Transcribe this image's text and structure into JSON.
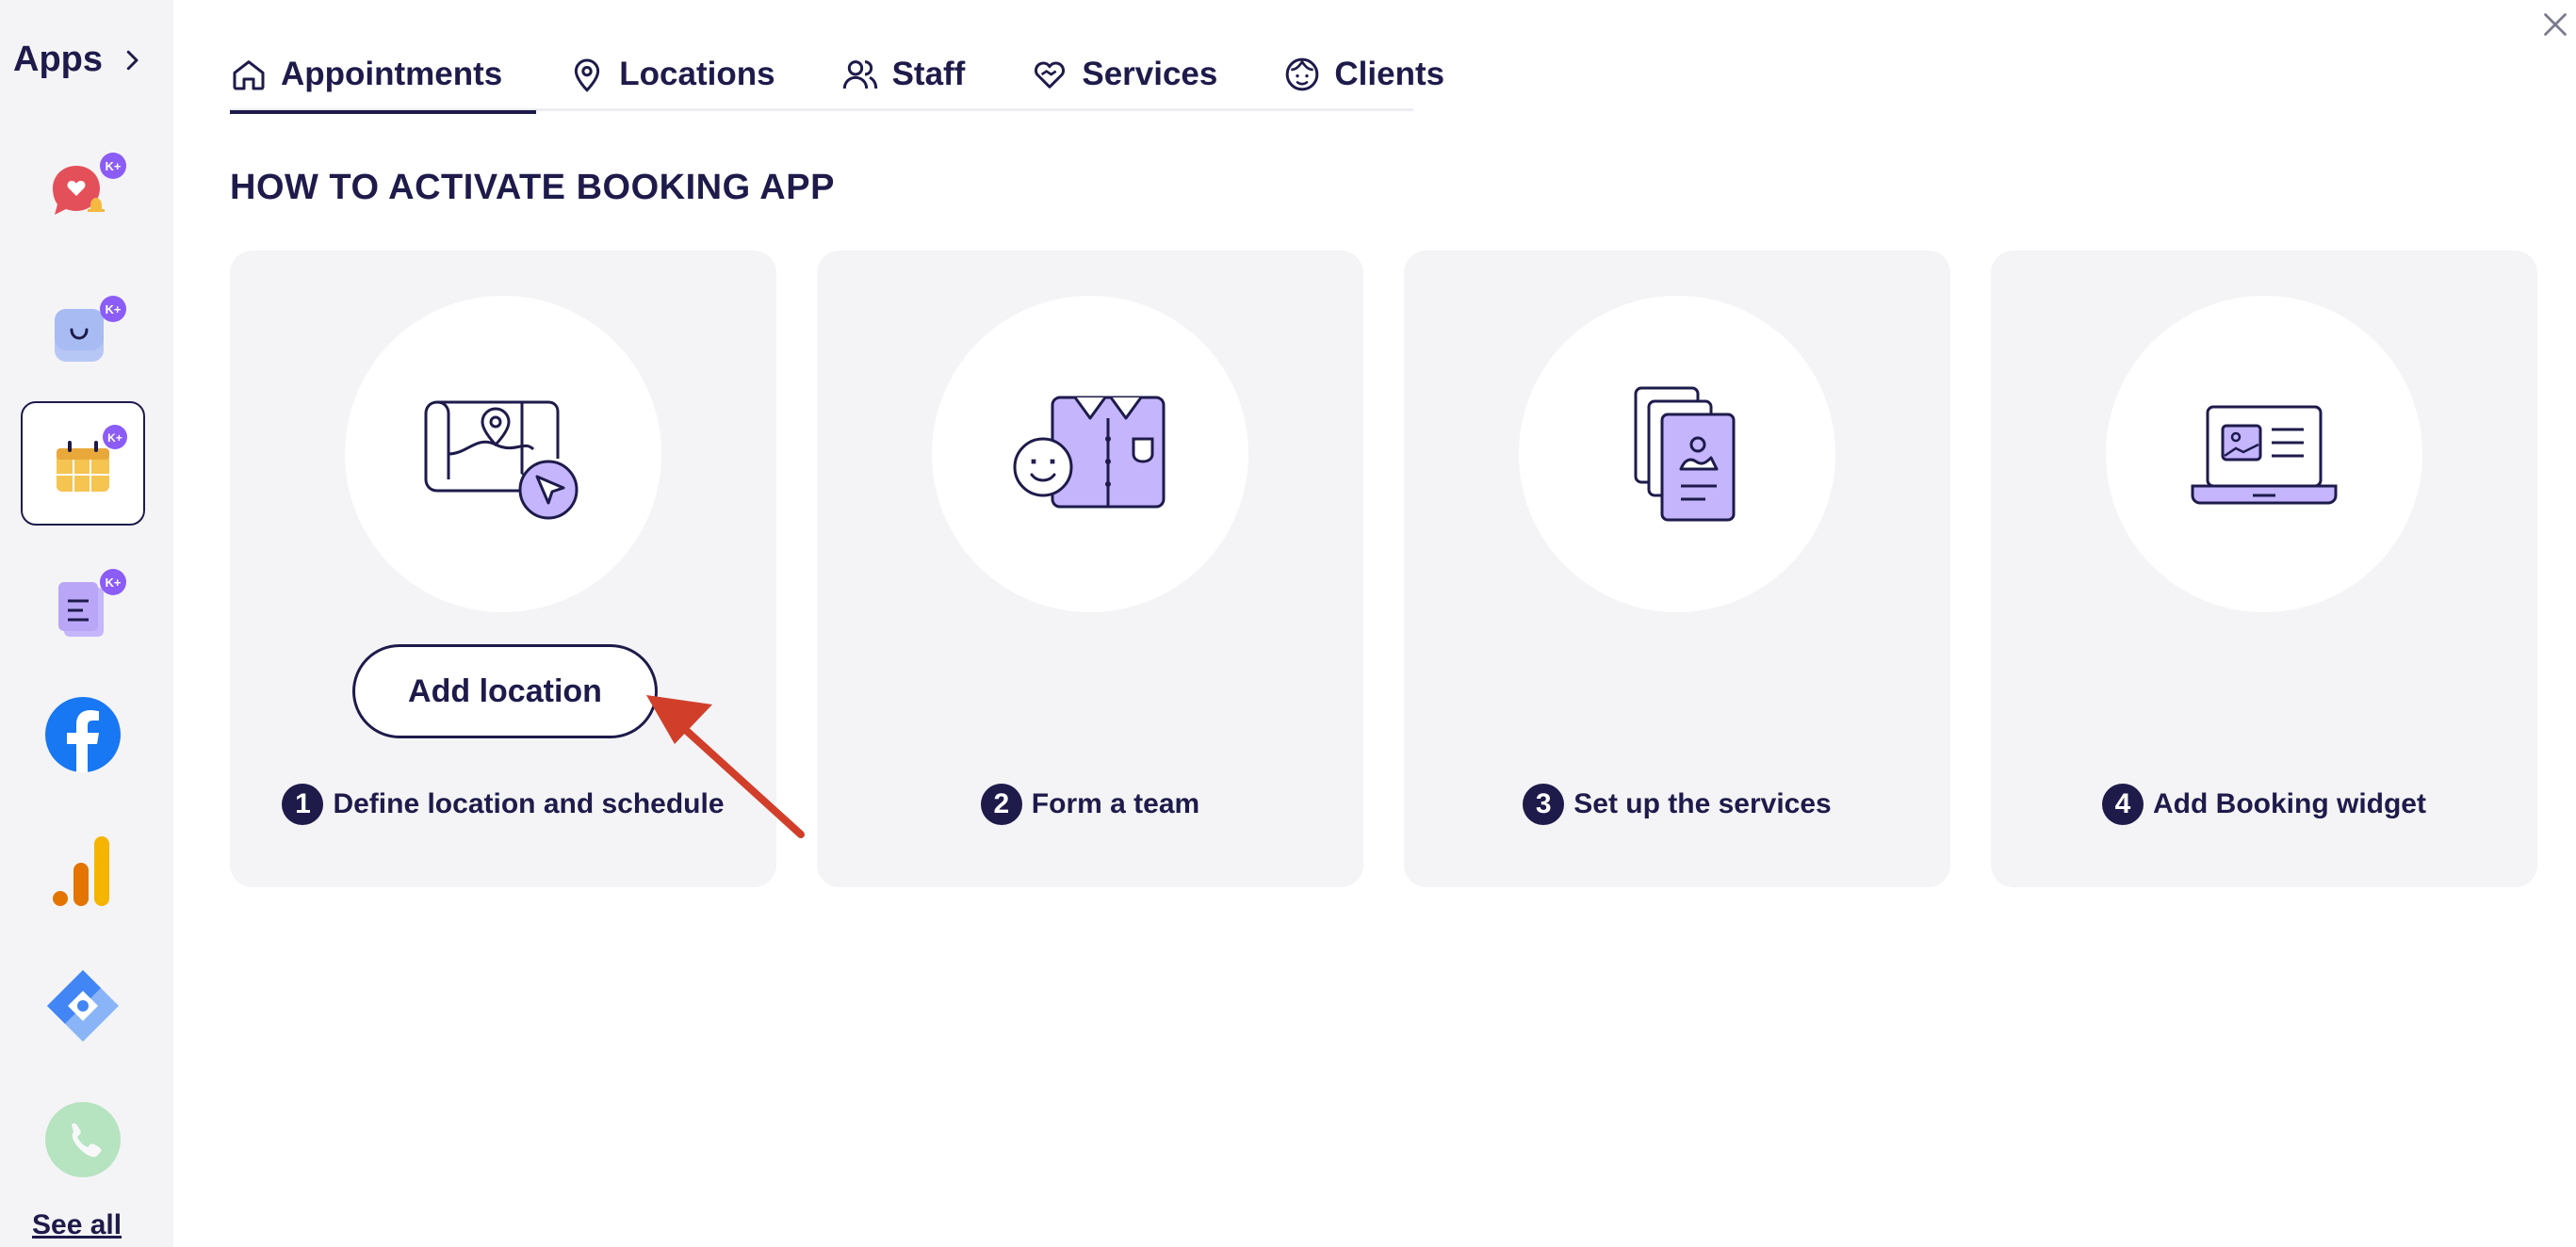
{
  "sidebar": {
    "title": "Apps",
    "see_all": "See all",
    "apps": [
      {
        "icon": "chat-heart-icon",
        "badge": "K+"
      },
      {
        "icon": "shopping-bag-icon",
        "badge": "K+"
      },
      {
        "icon": "calendar-booking-icon",
        "badge": "K+",
        "active": true
      },
      {
        "icon": "document-icon",
        "badge": "K+"
      },
      {
        "icon": "facebook-icon"
      },
      {
        "icon": "google-analytics-icon"
      },
      {
        "icon": "tag-manager-icon"
      },
      {
        "icon": "phone-icon"
      }
    ]
  },
  "tabs": [
    {
      "label": "Appointments",
      "icon": "home-icon",
      "active": true
    },
    {
      "label": "Locations",
      "icon": "location-pin-icon"
    },
    {
      "label": "Staff",
      "icon": "users-icon"
    },
    {
      "label": "Services",
      "icon": "heart-hand-icon"
    },
    {
      "label": "Clients",
      "icon": "face-icon"
    }
  ],
  "section_title": "HOW TO ACTIVATE BOOKING APP",
  "cards": [
    {
      "step": "1",
      "label": "Define location and schedule",
      "button": "Add location",
      "icon": "map-location-icon"
    },
    {
      "step": "2",
      "label": "Form a team",
      "icon": "team-shirt-icon"
    },
    {
      "step": "3",
      "label": "Set up the services",
      "icon": "services-cards-icon"
    },
    {
      "step": "4",
      "label": "Add Booking widget",
      "icon": "laptop-widget-icon"
    }
  ],
  "colors": {
    "primary": "#1e1b4b",
    "card_bg": "#f4f4f6",
    "accent_purple": "#c4b5fd",
    "arrow": "#d13f2a",
    "badge": "#8b5cf6"
  }
}
